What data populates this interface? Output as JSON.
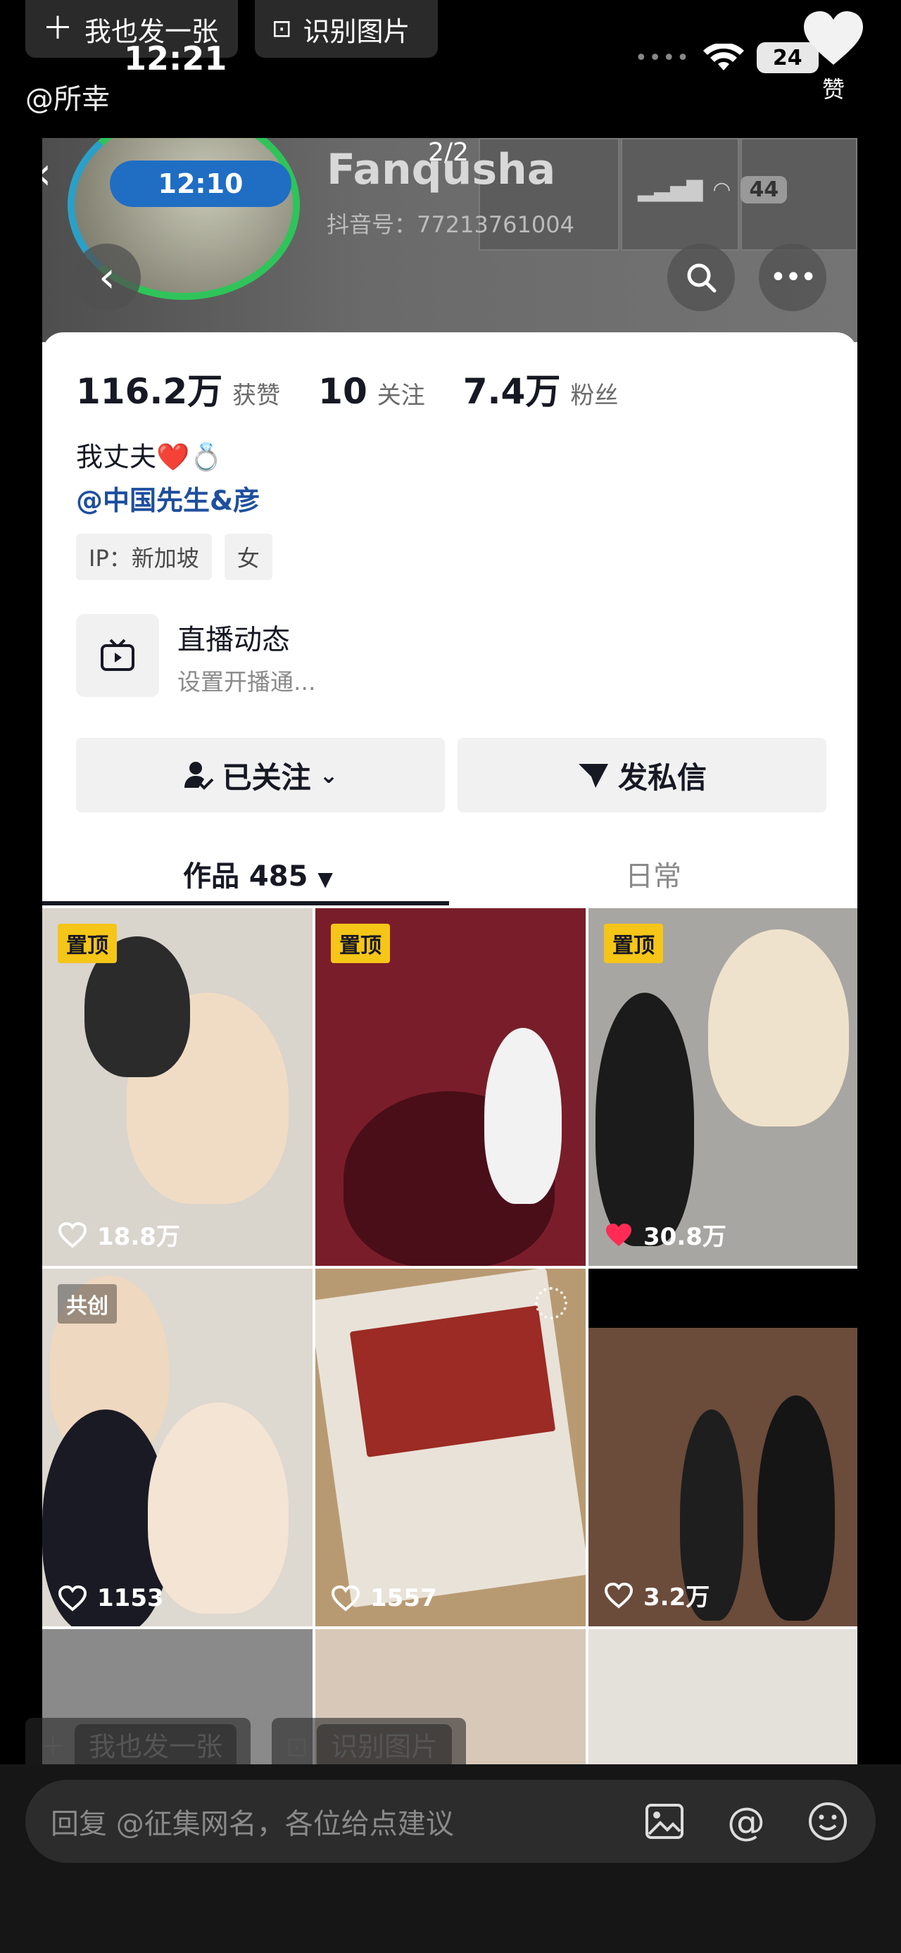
{
  "top": {
    "post_label": "我也发一张",
    "recognize_label": "识别图片",
    "time": "12:21",
    "author": "@所幸",
    "battery": "24",
    "like_label": "赞"
  },
  "shot": {
    "page_indicator": "2/2",
    "time_pill": "12:10",
    "nickname": "Fanqusha",
    "douyin_id": "抖音号：77213761004",
    "inner_battery": "44",
    "stats": {
      "likes_num": "116.2万",
      "likes_label": "获赞",
      "following_num": "10",
      "following_label": "关注",
      "fans_num": "7.4万",
      "fans_label": "粉丝"
    },
    "bio": "我丈夫❤️💍",
    "bio_link": "@中国先生&彦",
    "tags": [
      "IP：新加坡",
      "女"
    ],
    "live": {
      "title": "直播动态",
      "subtitle": "设置开播通..."
    },
    "followed_label": "已关注",
    "dm_label": "发私信",
    "tabs": {
      "works": "作品 485",
      "daily": "日常"
    },
    "videos": [
      {
        "badge": "置顶",
        "likes": "18.8万",
        "liked": false,
        "bg": "#d9d4cc"
      },
      {
        "badge": "置顶",
        "likes": "",
        "liked": false,
        "bg": "#7a1d2a"
      },
      {
        "badge": "置顶",
        "likes": "30.8万",
        "liked": true,
        "bg": "#a8a6a2"
      },
      {
        "badge": "共创",
        "likes": "1153",
        "liked": false,
        "bg": "#ddd8d0"
      },
      {
        "badge": "",
        "likes": "1557",
        "liked": false,
        "bg": "#b89a72"
      },
      {
        "badge": "",
        "likes": "3.2万",
        "liked": false,
        "bg": "#6b4b3a"
      }
    ]
  },
  "ghost": {
    "post_label": "我也发一张",
    "recognize_label": "识别图片"
  },
  "reply": {
    "placeholder": "回复 @征集网名，各位给点建议"
  }
}
